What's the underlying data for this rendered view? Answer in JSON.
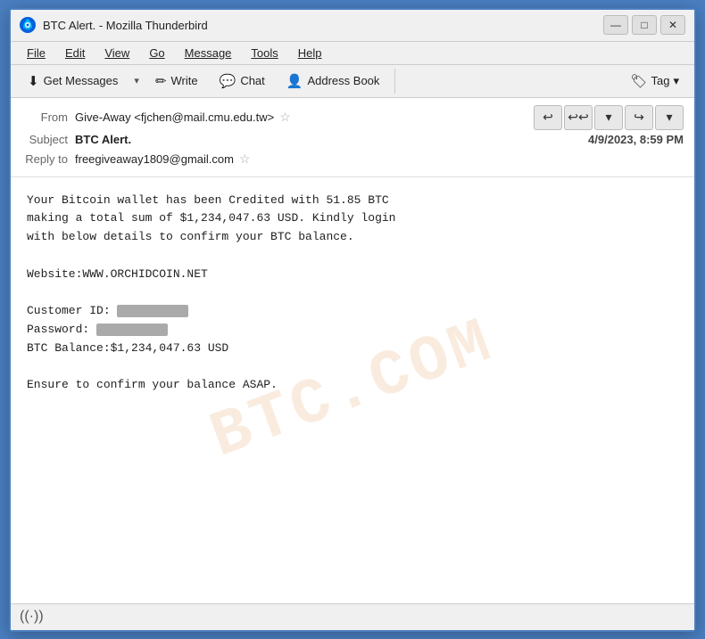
{
  "window": {
    "title": "BTC Alert. - Mozilla Thunderbird"
  },
  "title_controls": {
    "minimize": "—",
    "maximize": "□",
    "close": "✕"
  },
  "menu": {
    "items": [
      "File",
      "Edit",
      "View",
      "Go",
      "Message",
      "Tools",
      "Help"
    ]
  },
  "toolbar": {
    "get_messages": "Get Messages",
    "write": "Write",
    "chat": "Chat",
    "address_book": "Address Book",
    "tag": "Tag",
    "dropdown_arrow": "▾"
  },
  "email": {
    "from_label": "From",
    "from_value": "Give-Away <fjchen@mail.cmu.edu.tw>",
    "subject_label": "Subject",
    "subject_value": "BTC Alert.",
    "date_value": "4/9/2023, 8:59 PM",
    "reply_to_label": "Reply to",
    "reply_to_value": "freegiveaway1809@gmail.com",
    "body": "Your Bitcoin wallet has been Credited with 51.85 BTC\nmaking a total sum of $1,234,047.63 USD. Kindly login\nwith below details to confirm your BTC balance.\n\nWebsite:WWW.ORCHIDCOIN.NET\n\nCustomer ID:\nPassword:\nBTC Balance:$1,234,047.63 USD\n\nEnsure to confirm your balance ASAP."
  },
  "status_bar": {
    "icon": "((·))"
  },
  "watermark": {
    "text": "BTC.COM"
  }
}
